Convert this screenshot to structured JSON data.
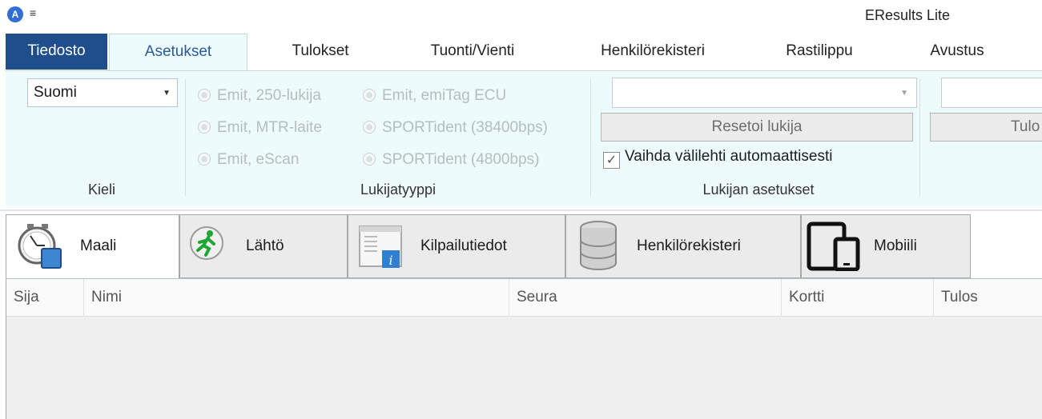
{
  "window": {
    "title": "EResults Lite",
    "app_icon_letter": "A",
    "qat_icon": "≡"
  },
  "ribbon_tabs": [
    {
      "label": "Tiedosto",
      "state": "file"
    },
    {
      "label": "Asetukset",
      "state": "selected"
    },
    {
      "label": "Tulokset"
    },
    {
      "label": "Tuonti/Vienti"
    },
    {
      "label": "Henkilörekisteri"
    },
    {
      "label": "Rastilippu"
    },
    {
      "label": "Avustus"
    }
  ],
  "ribbon": {
    "language": {
      "group_label": "Kieli",
      "selected": "Suomi"
    },
    "reader_type": {
      "group_label": "Lukijatyyppi",
      "options": [
        "Emit, 250-lukija",
        "Emit, MTR-laite",
        "Emit, eScan",
        "Emit, emiTag ECU",
        "SPORTident (38400bps)",
        "SPORTident (4800bps)"
      ]
    },
    "reader_settings": {
      "group_label": "Lukijan asetukset",
      "port_value": "",
      "reset_label": "Resetoi lukija",
      "auto_switch_label": "Vaihda välilehti automaattisesti",
      "auto_switch_checked": true,
      "check_mark": "✓"
    },
    "results_group": {
      "button_label_visible": "Tulo"
    }
  },
  "view_tabs": [
    {
      "label": "Maali",
      "icon": "stopwatch-icon",
      "active": true
    },
    {
      "label": "Lähtö",
      "icon": "runner-icon"
    },
    {
      "label": "Kilpailutiedot",
      "icon": "info-window-icon"
    },
    {
      "label": "Henkilörekisteri",
      "icon": "database-icon"
    },
    {
      "label": "Mobiili",
      "icon": "devices-icon"
    }
  ],
  "grid": {
    "columns": [
      "Sija",
      "Nimi",
      "Seura",
      "Kortti",
      "Tulos"
    ],
    "rows": []
  },
  "colors": {
    "file_tab": "#1e4e8c",
    "ribbon_bg": "#eefbfd",
    "selected_tab_text": "#2b5a9a",
    "disabled_text": "#b5bdc2"
  }
}
